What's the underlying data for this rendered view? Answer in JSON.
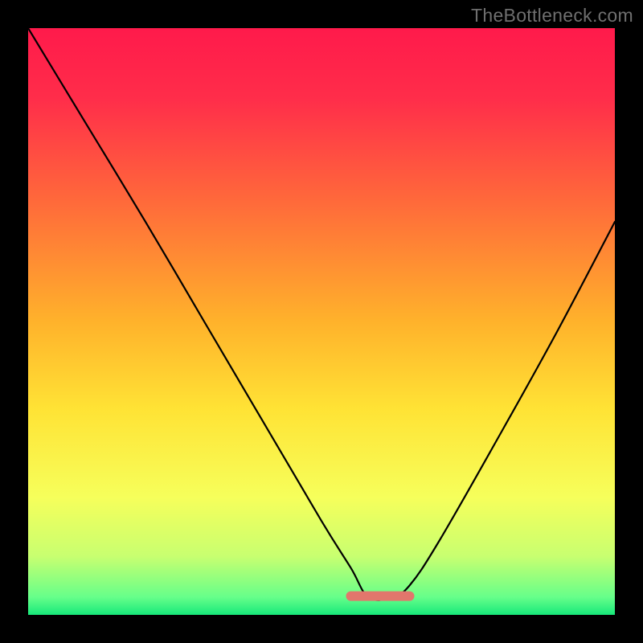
{
  "watermark": "TheBottleneck.com",
  "chart_data": {
    "type": "line",
    "title": "",
    "xlabel": "",
    "ylabel": "",
    "xlim": [
      0,
      100
    ],
    "ylim": [
      0,
      100
    ],
    "series": [
      {
        "name": "curve",
        "x": [
          0,
          10,
          20,
          30,
          40,
          50,
          55,
          58,
          62,
          65,
          70,
          80,
          90,
          100
        ],
        "values": [
          100,
          83.5,
          67,
          50,
          33,
          16,
          8,
          3,
          3,
          5,
          12.5,
          30,
          48,
          67
        ]
      }
    ],
    "flat_band": {
      "x_start": 55,
      "x_end": 65,
      "y": 3.2,
      "color": "#e2766c"
    },
    "background_gradient": {
      "stops": [
        {
          "offset": 0,
          "color": "#ff1a4b"
        },
        {
          "offset": 12,
          "color": "#ff2d4a"
        },
        {
          "offset": 30,
          "color": "#ff6b3a"
        },
        {
          "offset": 50,
          "color": "#ffb22b"
        },
        {
          "offset": 65,
          "color": "#ffe335"
        },
        {
          "offset": 80,
          "color": "#f6ff5b"
        },
        {
          "offset": 90,
          "color": "#c8ff70"
        },
        {
          "offset": 97,
          "color": "#66ff8a"
        },
        {
          "offset": 100,
          "color": "#17e87a"
        }
      ]
    }
  }
}
